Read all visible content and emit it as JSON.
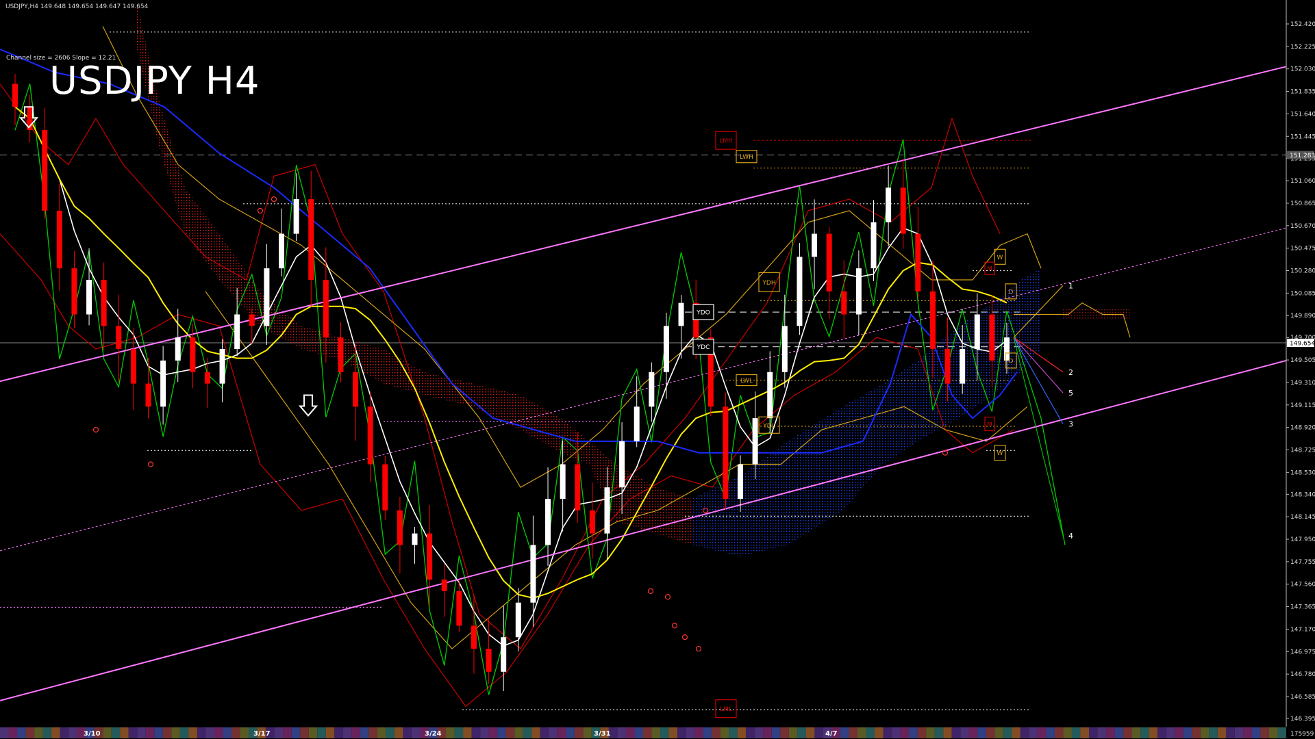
{
  "window": {
    "info_line": "USDJPY,H4  149.648 149.654 149.647 149.654",
    "channel_info": "Channel size = 2606 Slope = 12.21",
    "title_overlay": "USDJPY H4"
  },
  "axis": {
    "min": 146.395,
    "max": 152.42,
    "tick_labels": [
      "152.420",
      "152.225",
      "152.030",
      "151.835",
      "151.640",
      "151.445",
      "151.255",
      "151.060",
      "150.865",
      "150.670",
      "150.475",
      "150.280",
      "150.085",
      "149.890",
      "149.700",
      "149.505",
      "149.310",
      "149.115",
      "148.920",
      "148.725",
      "148.530",
      "148.340",
      "148.145",
      "147.950",
      "147.755",
      "147.560",
      "147.365",
      "147.170",
      "146.975",
      "146.780",
      "146.585",
      "146.395"
    ],
    "current_price_label": "149.654",
    "current_price": 149.654,
    "marked_price_label": "151.283",
    "marked_price": 151.283
  },
  "time_axis": {
    "date_labels": [
      "3/10",
      "3/17",
      "3/24",
      "3/31",
      "4/7"
    ],
    "stats_value": "175959"
  },
  "level_labels": {
    "lmh": "LMH",
    "lwh": "LWH",
    "ydh": "YDH",
    "ydo": "YDO",
    "ydc": "YDC",
    "lwl": "LWL",
    "ydl": "YDL",
    "lml": "LML",
    "week_high": "W",
    "day_high": "D",
    "day_low": "D",
    "month_low": "M",
    "week_low": "W",
    "month_high": "M"
  },
  "projections": [
    "1",
    "2",
    "5",
    "3",
    "4"
  ],
  "colors": {
    "background": "#000000",
    "channel": "#ff77ff",
    "bull_candle": "#ffffff",
    "bear_candle": "#ff0000",
    "ma_white": "#ffffff",
    "ma_yellow": "#ffee00",
    "ma_blue": "#1a2bff",
    "green_line": "#00cc00",
    "red_band": "#cc0000",
    "gold": "#d4a017",
    "cloud_red": "#ff2222",
    "cloud_blue": "#2244ff"
  },
  "chart_data": {
    "type": "candlestick",
    "symbol": "USDJPY",
    "timeframe": "H4",
    "ylim": [
      146.395,
      152.42
    ],
    "x_date_labels": [
      "3/10",
      "3/17",
      "3/24",
      "3/31",
      "4/7"
    ],
    "levels": {
      "LMH": 151.41,
      "LWH": 151.22,
      "YDH": 150.18,
      "YDO": 149.92,
      "YDC": 149.62,
      "LWL": 149.33,
      "YDL": 148.94,
      "LML": 146.45
    },
    "current_price": 149.654,
    "candles_close_approx": [
      151.7,
      151.5,
      150.8,
      150.3,
      149.9,
      150.2,
      149.8,
      149.6,
      149.3,
      149.1,
      149.5,
      149.7,
      149.4,
      149.3,
      149.6,
      149.9,
      149.8,
      150.3,
      150.6,
      150.9,
      150.2,
      149.7,
      149.4,
      149.1,
      148.6,
      148.2,
      147.9,
      148.0,
      147.6,
      147.5,
      147.2,
      147.0,
      146.8,
      147.1,
      147.4,
      147.9,
      148.3,
      148.6,
      148.2,
      148.0,
      148.4,
      148.8,
      149.1,
      149.4,
      149.8,
      150.0,
      149.7,
      149.1,
      148.3,
      148.6,
      149.0,
      149.4,
      149.8,
      150.4,
      150.6,
      150.1,
      149.9,
      150.3,
      150.7,
      151.0,
      150.6,
      150.1,
      149.6,
      149.3,
      149.6,
      149.9,
      149.5,
      149.7
    ]
  }
}
